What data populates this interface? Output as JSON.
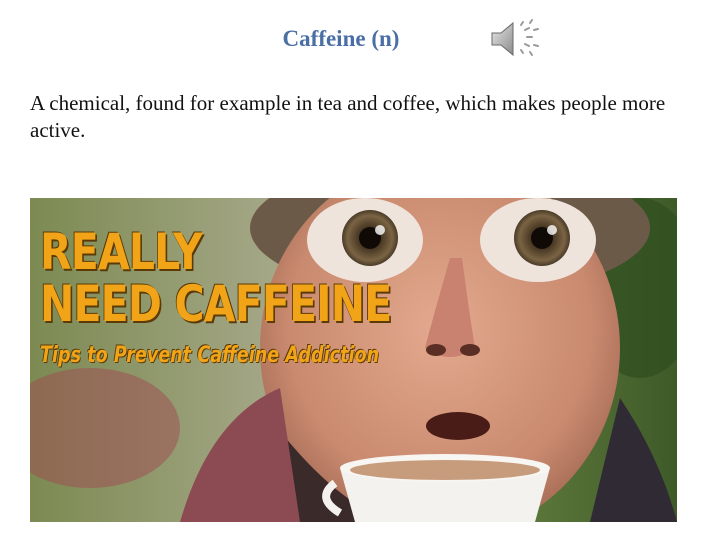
{
  "slide": {
    "title": "Caffeine (n)",
    "definition": "A chemical, found for example in tea and coffee, which makes people more active."
  },
  "audio": {
    "icon": "speaker-icon"
  },
  "photo": {
    "headline_line1": "REALLY",
    "headline_line2": "NEED CAFFEINE",
    "subline": "Tips to Prevent Caffeine Addiction",
    "text_color": "#f2a418"
  }
}
